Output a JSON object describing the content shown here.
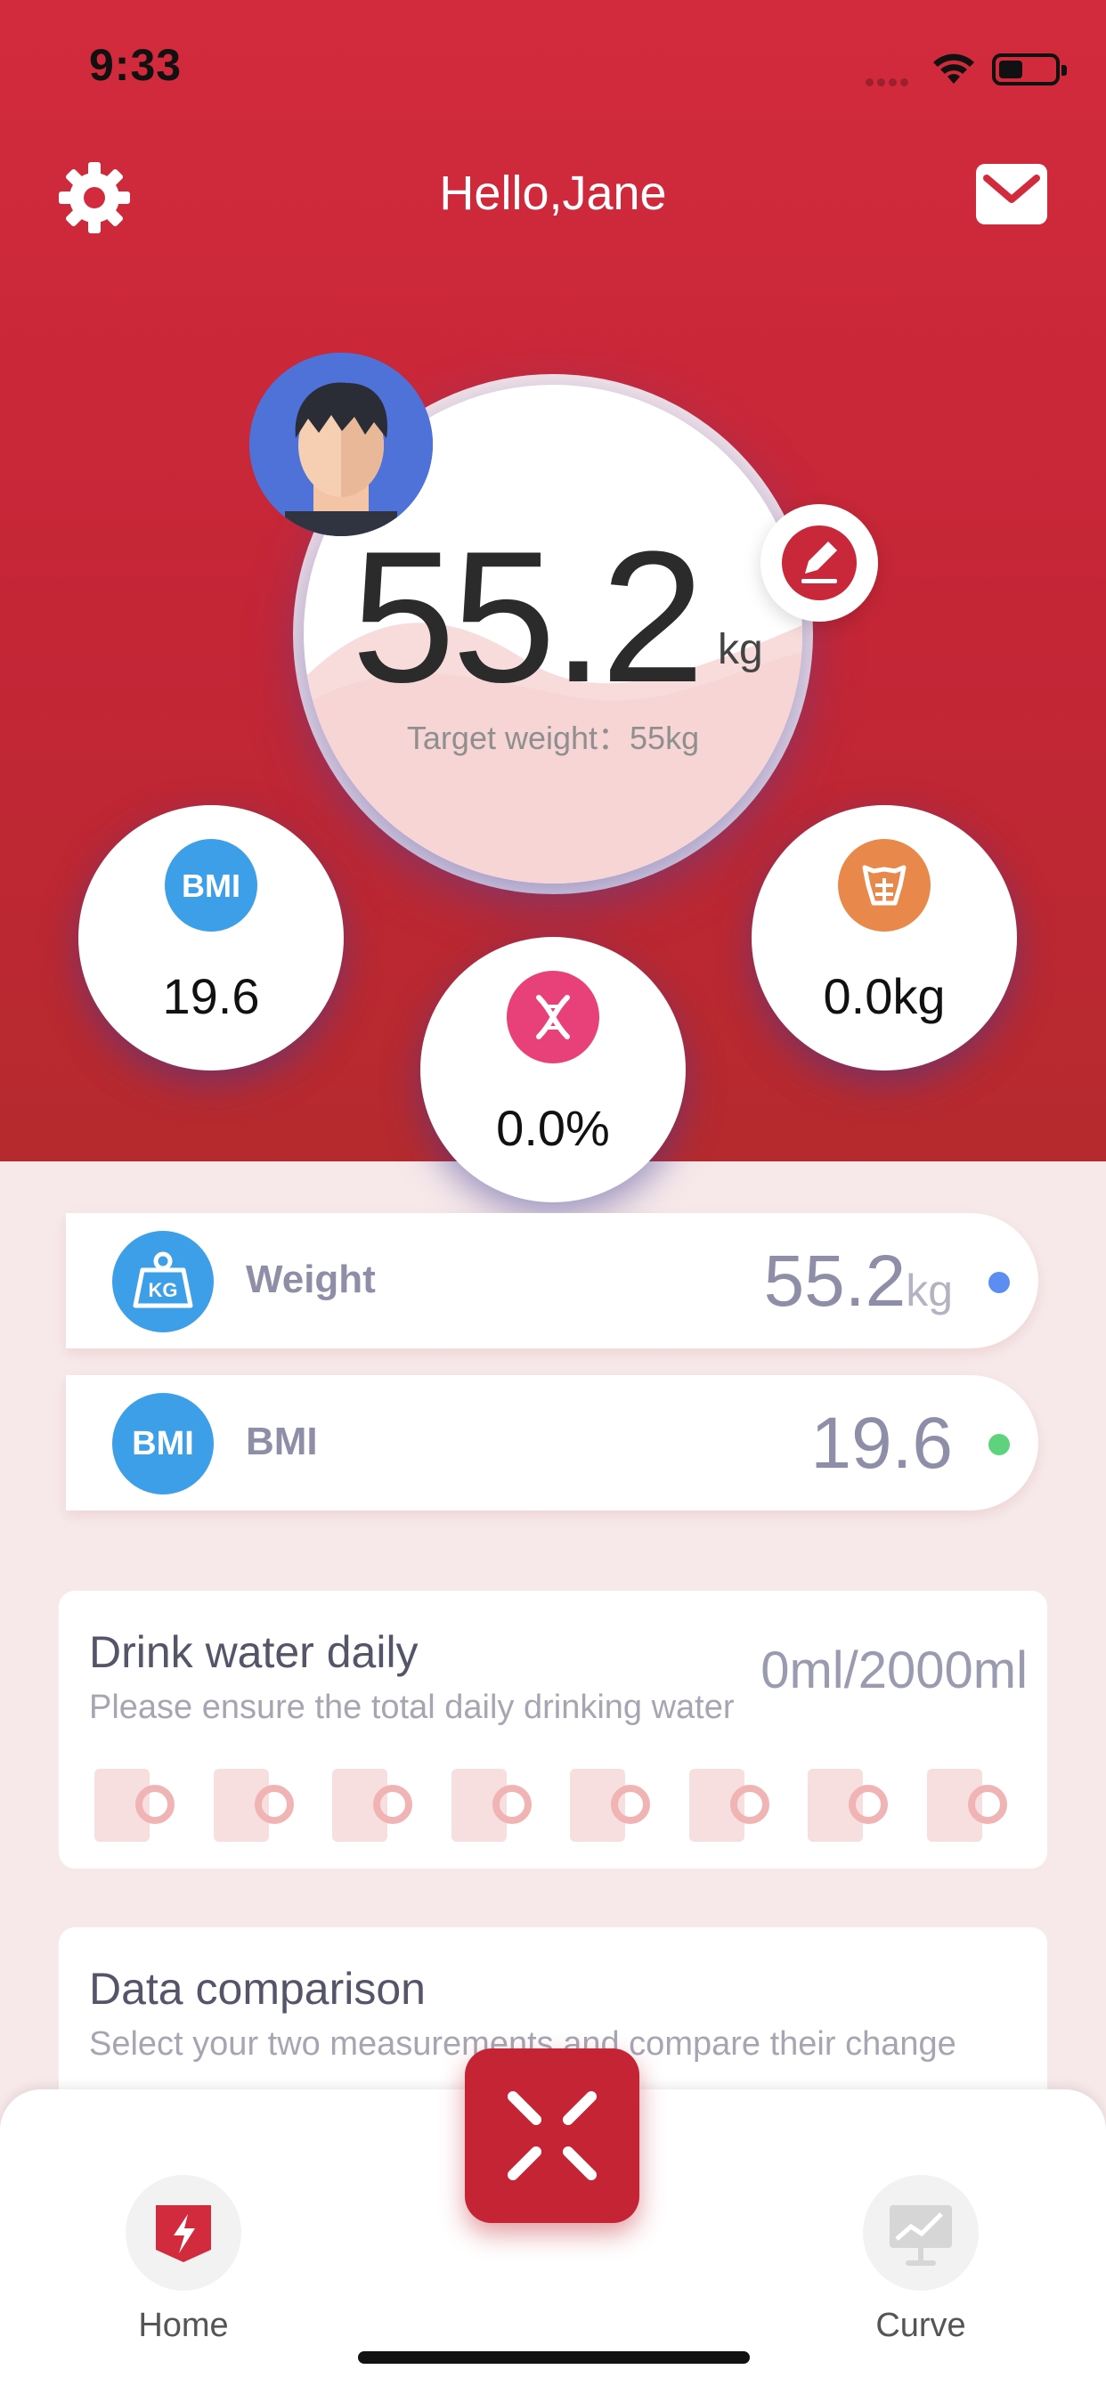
{
  "status_bar": {
    "time": "9:33"
  },
  "header": {
    "greeting": "Hello,Jane"
  },
  "weight_display": {
    "value": "55.2",
    "unit": "kg",
    "target": "Target weight：55kg"
  },
  "metrics": {
    "bmi": {
      "icon_text": "BMI",
      "value": "19.6"
    },
    "body_fat": {
      "value": "0.0%"
    },
    "muscle": {
      "value": "0.0kg"
    }
  },
  "summary_rows": [
    {
      "label": "Weight",
      "value": "55.2",
      "unit": "kg",
      "icon_text": "KG",
      "dot_color": "#5b8ef0"
    },
    {
      "label": "BMI",
      "value": "19.6",
      "unit": "",
      "icon_text": "BMI",
      "dot_color": "#5fd27d"
    }
  ],
  "water": {
    "title": "Drink water daily",
    "subtitle": "Please ensure the total daily drinking water",
    "amount": "0ml/2000ml",
    "cups_filled": 0,
    "cups_total": 8
  },
  "comparison": {
    "title": "Data comparison",
    "subtitle": "Select your two measurements and compare their change"
  },
  "tabs": {
    "home": "Home",
    "curve": "Curve"
  },
  "colors": {
    "primary": "#d22b3d",
    "background": "#f7e9ea",
    "bmi_icon": "#3d9fe8",
    "fat_icon": "#e8417a",
    "muscle_icon": "#e8884a"
  }
}
